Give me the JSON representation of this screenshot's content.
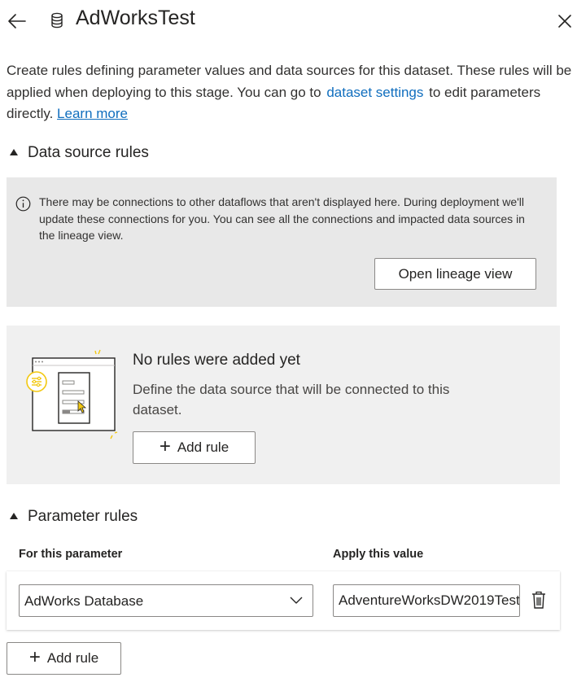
{
  "header": {
    "title": "AdWorksTest",
    "back_icon": "back-arrow-icon",
    "dataset_icon": "database-icon",
    "close_icon": "close-icon"
  },
  "description": {
    "text_1": "Create rules defining parameter values and data sources for this dataset. These rules will be applied when deploying to this stage. You can go to",
    "settings_link": "dataset settings",
    "text_2": "to edit parameters directly.",
    "learn_more": "Learn more"
  },
  "data_source_rules": {
    "title": "Data source rules",
    "info_text": "There may be connections to other dataflows that aren't displayed here. During deployment we'll update these connections for you. You can see all the connections and impacted data sources in the lineage view.",
    "lineage_button": "Open lineage view",
    "empty_title": "No rules were added yet",
    "empty_desc": "Define the data source that will be connected to this dataset.",
    "add_rule": "Add rule"
  },
  "parameter_rules": {
    "title": "Parameter rules",
    "col_parameter": "For this parameter",
    "col_value": "Apply this value",
    "rows": [
      {
        "parameter": "AdWorks Database",
        "value": "AdventureWorksDW2019Test"
      }
    ],
    "add_rule": "Add rule"
  },
  "colors": {
    "link": "#106ebe",
    "info_bg": "#e8e8e8",
    "empty_bg": "#f0f0f0",
    "accent_yellow": "#f2c811"
  }
}
